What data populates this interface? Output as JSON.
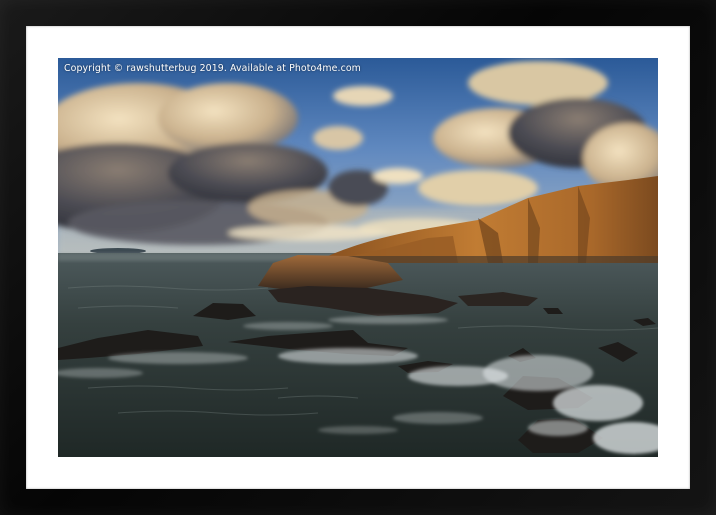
{
  "watermark": {
    "text": "Copyright © rawshutterbug  2019. Available at Photo4me.com"
  },
  "photo": {
    "subject": "coastal-cliffs-at-sunset",
    "colors": {
      "sky_top": "#2f5f9c",
      "sky_mid": "#6d93c4",
      "cloud_light": "#e8d2a8",
      "cloud_dark": "#3c3d44",
      "cliff_lit": "#b7742f",
      "cliff_shadow": "#5a3516",
      "sea": "#2c3633",
      "surf": "#e9ecec"
    }
  }
}
